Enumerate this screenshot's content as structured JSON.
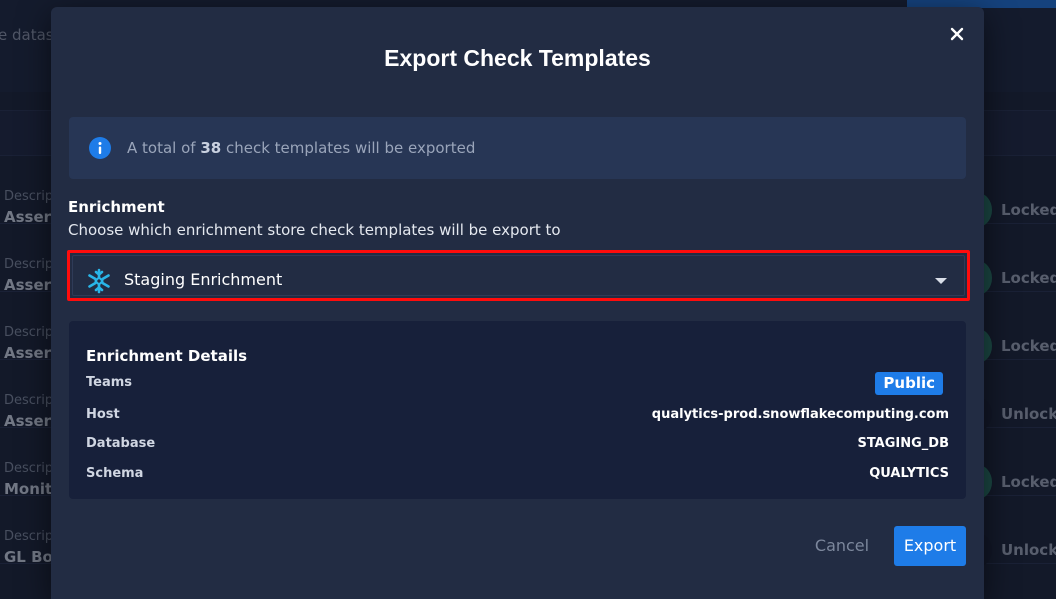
{
  "background": {
    "search_fragment": "e datas",
    "rows": [
      {
        "label": "Descrip",
        "value": "Assert",
        "status": "Locked",
        "circle_color": "#2a7a6a"
      },
      {
        "label": "Descrip",
        "value": "Assert",
        "status": "Locked",
        "circle_color": "#2a7a6a"
      },
      {
        "label": "Descrip",
        "value": "Assert",
        "status": "Locked",
        "circle_color": "#2a7a6a"
      },
      {
        "label": "Descrip",
        "value": "Assert",
        "status": "Unlocke",
        "circle_color": "#1b2236"
      },
      {
        "label": "Descrip",
        "value": "Monito",
        "status": "Locked",
        "circle_color": "#2a7a6a"
      },
      {
        "label": "Descrip",
        "value": "GL Boo",
        "status": "Unlocke",
        "circle_color": "#1b2236"
      }
    ]
  },
  "modal": {
    "title": "Export Check Templates",
    "close_icon": "close-icon",
    "info": {
      "icon": "info-icon",
      "prefix": "A total of ",
      "count": "38",
      "suffix": " check templates will be exported"
    },
    "enrichment": {
      "label": "Enrichment",
      "description": "Choose which enrichment store check templates will be export to",
      "selected": "Staging Enrichment",
      "selected_icon": "snowflake-icon",
      "highlight_color": "#ff0c0c"
    },
    "details": {
      "title": "Enrichment Details",
      "teams_label": "Teams",
      "teams_value": "Public",
      "host_label": "Host",
      "host_value": "qualytics-prod.snowflakecomputing.com",
      "database_label": "Database",
      "database_value": "STAGING_DB",
      "schema_label": "Schema",
      "schema_value": "QUALYTICS"
    },
    "actions": {
      "cancel_label": "Cancel",
      "export_label": "Export",
      "accent_color": "#1e7ce8"
    }
  }
}
